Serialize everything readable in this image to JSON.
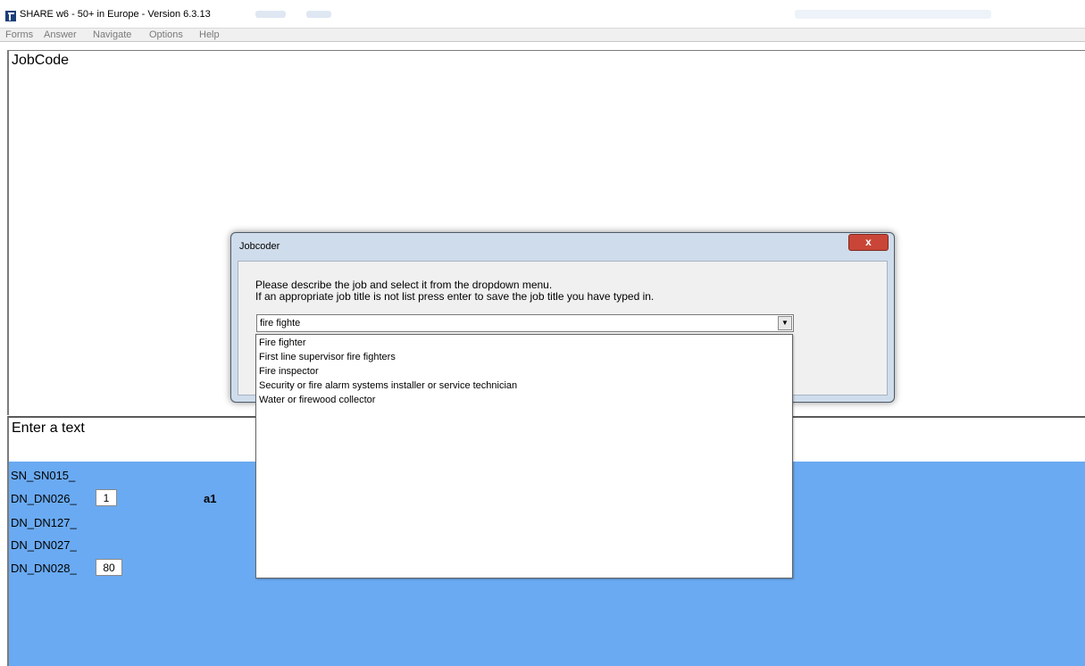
{
  "window": {
    "title": "SHARE w6 - 50+ in Europe - Version 6.3.13"
  },
  "menu": {
    "items": [
      "Forms",
      "Answer",
      "Navigate",
      "Options",
      "Help"
    ]
  },
  "question": {
    "label": "JobCode"
  },
  "hint": {
    "label": "Enter a text"
  },
  "route": {
    "rows": [
      {
        "name": "SN_SN015_",
        "value": null,
        "extra": null
      },
      {
        "name": "DN_DN026_",
        "value": "1",
        "extra": "a1"
      },
      {
        "name": "DN_DN127_",
        "value": null,
        "extra": null
      },
      {
        "name": "DN_DN027_",
        "value": null,
        "extra": null
      },
      {
        "name": "DN_DN028_",
        "value": "80",
        "extra": null
      }
    ],
    "background_color": "#6aaaf2"
  },
  "dialog": {
    "title": "Jobcoder",
    "close_glyph": "x",
    "line1": "Please describe the job and select it from the dropdown menu.",
    "line2": "If an appropriate job title is not list press enter to save the job title you have typed in.",
    "input_value": "fire fighte",
    "dropdown_button": "▼",
    "options": [
      "Fire fighter",
      "First line supervisor fire fighters",
      "Fire inspector",
      "Security or fire alarm systems installer or service technician",
      "Water or firewood collector"
    ]
  },
  "icons": {
    "app_icon": "app-logo-icon",
    "close_icon": "close-icon",
    "dropdown_icon": "chevron-down-icon"
  }
}
